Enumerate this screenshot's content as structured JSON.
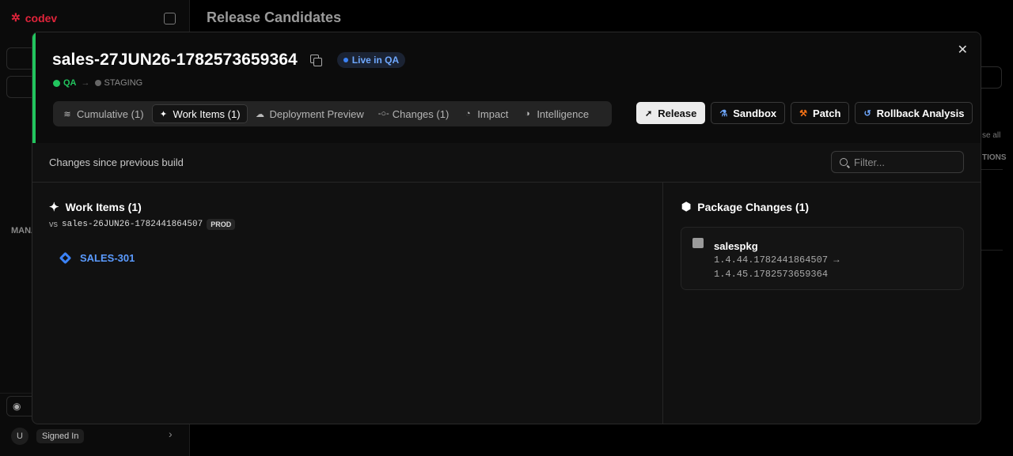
{
  "sidebar": {
    "brand": "codev",
    "footer": {
      "avatar_initial": "U",
      "signed_in": "Signed In"
    },
    "section_label": "MANA"
  },
  "background": {
    "page_title": "Release Candidates",
    "right_text_1": "se all",
    "right_text_2": "TIONS"
  },
  "modal": {
    "title": "sales-27JUN26-1782573659364",
    "status_badge": "Live in QA",
    "environments": {
      "current": "QA",
      "next": "STAGING"
    },
    "tabs": [
      {
        "label": "Cumulative (1)",
        "icon": "layers-icon"
      },
      {
        "label": "Work Items (1)",
        "icon": "sparkles-icon",
        "active": true
      },
      {
        "label": "Deployment Preview",
        "icon": "cloud-icon"
      },
      {
        "label": "Changes (1)",
        "icon": "commit-icon"
      },
      {
        "label": "Impact",
        "icon": "gauge-icon"
      },
      {
        "label": "Intelligence",
        "icon": "brain-icon"
      }
    ],
    "actions": {
      "release": "Release",
      "sandbox": "Sandbox",
      "patch": "Patch",
      "rollback": "Rollback Analysis"
    },
    "subbar": {
      "label": "Changes since previous build",
      "filter_placeholder": "Filter..."
    },
    "work_items": {
      "heading": "Work Items (1)",
      "vs_label": "vs",
      "compare_build": "sales-26JUN26-1782441864507",
      "compare_env": "PROD",
      "items": [
        "SALES-301"
      ]
    },
    "packages": {
      "heading": "Package Changes (1)",
      "items": [
        {
          "name": "salespkg",
          "from_version": "1.4.44.1782441864507",
          "arrow": "→",
          "to_version": "1.4.45.1782573659364"
        }
      ]
    }
  },
  "colors": {
    "accent_green": "#22c55e",
    "link_blue": "#5b9bff",
    "brand_red": "#e0243b",
    "patch_orange": "#f97316"
  }
}
